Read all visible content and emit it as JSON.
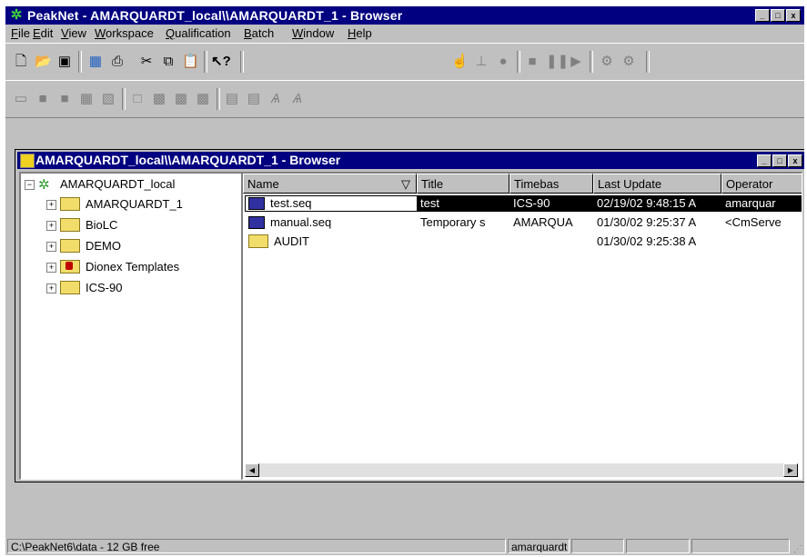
{
  "app": {
    "title": "PeakNet - AMARQUARDT_local\\\\AMARQUARDT_1 - Browser",
    "window_buttons": [
      "_",
      "□",
      "x"
    ]
  },
  "menu": [
    "File",
    "Edit",
    "View",
    "Workspace",
    "Qualification",
    "Batch",
    "Window",
    "Help"
  ],
  "toolbar1": {
    "icons": [
      "new-icon",
      "open-icon",
      "save-icon",
      "print-preview-icon",
      "print-icon",
      "cut-icon",
      "copy-icon",
      "paste-icon",
      "context-help-icon",
      "hand-icon",
      "pump-icon",
      "inject-icon",
      "stop-icon",
      "pause-icon",
      "play-icon",
      "batch-start-icon",
      "batch-stop-icon"
    ]
  },
  "toolbar2": {
    "icons": [
      "monitor-icon",
      "panel-icon",
      "panel2-icon",
      "grid-icon",
      "chart-icon",
      "window-icon",
      "table-icon",
      "table2-icon",
      "table3-icon",
      "report-icon",
      "report2-icon",
      "peak-icon",
      "peak2-icon"
    ]
  },
  "browser": {
    "title": "AMARQUARDT_local\\\\AMARQUARDT_1 - Browser",
    "tree": {
      "root": "AMARQUARDT_local",
      "children": [
        "AMARQUARDT_1",
        "BioLC",
        "DEMO",
        "Dionex Templates",
        "ICS-90"
      ]
    },
    "columns": [
      "Name",
      "Title",
      "Timebas",
      "Last Update",
      "Operator"
    ],
    "rows": [
      {
        "name": "test.seq",
        "title": "test",
        "timebase": "ICS-90",
        "last_update": "02/19/02 9:48:15 A",
        "operator": "amarquar"
      },
      {
        "name": "manual.seq",
        "title": "Temporary s",
        "timebase": "AMARQUA",
        "last_update": "01/30/02 9:25:37 A",
        "operator": "<CmServe"
      },
      {
        "name": "AUDIT",
        "title": "",
        "timebase": "",
        "last_update": "01/30/02 9:25:38 A",
        "operator": ""
      }
    ]
  },
  "status": {
    "path": "C:\\PeakNet6\\data - 12 GB free",
    "user": "amarquardt"
  }
}
